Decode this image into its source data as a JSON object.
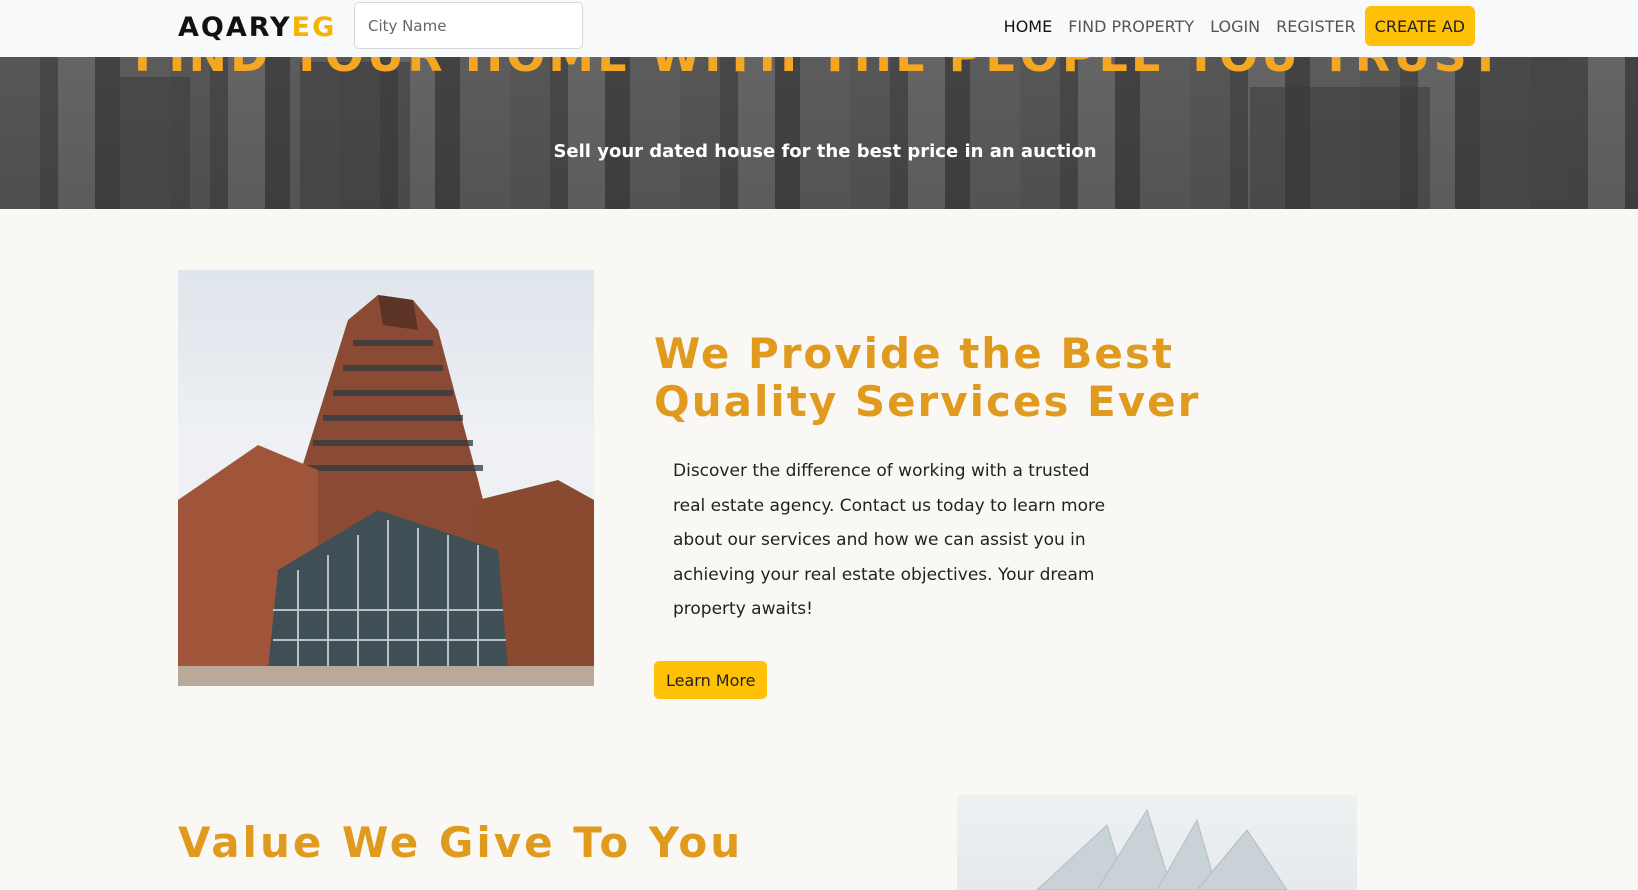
{
  "navbar": {
    "brand_main": "AQARY",
    "brand_accent": "EG",
    "search_placeholder": "City Name",
    "links": [
      "HOME",
      "FIND PROPERTY",
      "LOGIN",
      "REGISTER"
    ],
    "create_ad": "CREATE AD"
  },
  "hero": {
    "title": "FIND YOUR HOME WITH THE PEOPLE YOU TRUST",
    "subtitle": "Sell your dated house for the best price in an auction"
  },
  "services": {
    "title": "We Provide the Best Quality Services Ever",
    "text": "Discover the difference of working with a trusted real estate agency. Contact us today to learn more about our services and how we can assist you in achieving your real estate objectives. Your dream property awaits!",
    "button": "Learn More"
  },
  "value": {
    "title": "Value We Give To You"
  },
  "colors": {
    "accent": "#ffc107",
    "heading": "#e09a1e",
    "hero_title": "#f5a623"
  }
}
